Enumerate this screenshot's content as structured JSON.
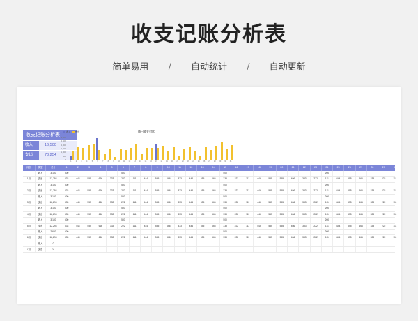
{
  "title": "收支记账分析表",
  "features": [
    "简单易用",
    "自动统计",
    "自动更新"
  ],
  "separator": "/",
  "summary": {
    "heading": "收支记账分析表",
    "income_label": "收入",
    "income_value": "16,500",
    "expense_label": "支出",
    "expense_value": "73,254"
  },
  "colors": {
    "accent": "#7b85d8",
    "income_bar": "#6b74cc",
    "expense_bar": "#f2c12e"
  },
  "chart_data": {
    "type": "bar",
    "title": "每日收支对比",
    "legend": [
      "收入",
      "支出"
    ],
    "categories": [
      "1",
      "2",
      "3",
      "4",
      "5",
      "6",
      "7",
      "8",
      "9",
      "10",
      "11",
      "12",
      "13",
      "14",
      "15",
      "16",
      "17",
      "18",
      "19",
      "20",
      "21",
      "22",
      "23",
      "24",
      "25",
      "26",
      "27",
      "28",
      "29",
      "30",
      "31"
    ],
    "y_ticks": [
      "3,000",
      "2,500",
      "2,000",
      "1,500",
      "1,000",
      "500",
      "0"
    ],
    "ylim": [
      0,
      3000
    ],
    "series": [
      {
        "name": "收入",
        "values": [
          600,
          0,
          0,
          0,
          0,
          2900,
          0,
          0,
          0,
          0,
          0,
          0,
          0,
          0,
          0,
          0,
          2200,
          0,
          0,
          0,
          0,
          0,
          0,
          0,
          0,
          0,
          0,
          0,
          0,
          0,
          0
        ]
      },
      {
        "name": "支出",
        "values": [
          1100,
          1800,
          1600,
          2000,
          2100,
          1300,
          800,
          1400,
          400,
          1500,
          1300,
          1600,
          2200,
          800,
          1600,
          1600,
          1600,
          1900,
          1100,
          1800,
          500,
          1500,
          1700,
          1200,
          600,
          1800,
          1300,
          1900,
          2300,
          1400,
          2000
        ]
      }
    ]
  },
  "table": {
    "headers": [
      "月份",
      "类型",
      "总计",
      "1",
      "2",
      "3",
      "4",
      "5",
      "6",
      "7",
      "8",
      "9",
      "10",
      "11",
      "12",
      "13",
      "14",
      "15",
      "16",
      "17",
      "18",
      "19",
      "20",
      "21",
      "22",
      "23",
      "24",
      "25",
      "26",
      "27",
      "28",
      "29",
      "30",
      "31"
    ],
    "rows": [
      {
        "month": "",
        "type": "收入",
        "total": "3,100",
        "days": [
          "600",
          "",
          "",
          "",
          "",
          "500",
          "",
          "",
          "",
          "",
          "",
          "",
          "",
          "",
          "500",
          "",
          "",
          "",
          "",
          "",
          "",
          "",
          "",
          "200",
          "",
          "",
          "",
          "",
          "",
          "",
          ""
        ]
      },
      {
        "month": "1月",
        "type": "支出",
        "total": "12,294",
        "days": [
          "333",
          "444",
          "555",
          "666",
          "333",
          "222",
          "111",
          "444",
          "555",
          "666",
          "333",
          "444",
          "555",
          "666",
          "333",
          "222",
          "111",
          "444",
          "555",
          "555",
          "666",
          "333",
          "222",
          "111",
          "444",
          "555",
          "666",
          "333",
          "222",
          "111",
          "444"
        ]
      },
      {
        "month": "",
        "type": "收入",
        "total": "3,100",
        "days": [
          "600",
          "",
          "",
          "",
          "",
          "500",
          "",
          "",
          "",
          "",
          "",
          "",
          "",
          "",
          "500",
          "",
          "",
          "",
          "",
          "",
          "",
          "",
          "",
          "200",
          "",
          "",
          "",
          "",
          "",
          "",
          ""
        ]
      },
      {
        "month": "2月",
        "type": "支出",
        "total": "12,294",
        "days": [
          "333",
          "444",
          "555",
          "666",
          "333",
          "222",
          "111",
          "444",
          "555",
          "666",
          "333",
          "444",
          "555",
          "666",
          "333",
          "222",
          "111",
          "444",
          "555",
          "555",
          "666",
          "333",
          "222",
          "111",
          "444",
          "555",
          "666",
          "333",
          "222",
          "111",
          "444"
        ]
      },
      {
        "month": "",
        "type": "收入",
        "total": "3,100",
        "days": [
          "600",
          "",
          "",
          "",
          "",
          "500",
          "",
          "",
          "",
          "",
          "",
          "",
          "",
          "",
          "500",
          "",
          "",
          "",
          "",
          "",
          "",
          "",
          "",
          "200",
          "",
          "",
          "",
          "",
          "",
          "",
          ""
        ]
      },
      {
        "month": "3月",
        "type": "支出",
        "total": "12,294",
        "days": [
          "333",
          "444",
          "555",
          "666",
          "333",
          "222",
          "111",
          "444",
          "555",
          "666",
          "333",
          "444",
          "555",
          "666",
          "333",
          "222",
          "111",
          "444",
          "555",
          "555",
          "666",
          "333",
          "222",
          "111",
          "444",
          "555",
          "666",
          "333",
          "222",
          "111",
          "444"
        ]
      },
      {
        "month": "",
        "type": "收入",
        "total": "3,100",
        "days": [
          "600",
          "",
          "",
          "",
          "",
          "500",
          "",
          "",
          "",
          "",
          "",
          "",
          "",
          "",
          "500",
          "",
          "",
          "",
          "",
          "",
          "",
          "",
          "",
          "200",
          "",
          "",
          "",
          "",
          "",
          "",
          ""
        ]
      },
      {
        "month": "4月",
        "type": "支出",
        "total": "12,294",
        "days": [
          "333",
          "444",
          "555",
          "666",
          "333",
          "222",
          "111",
          "444",
          "555",
          "666",
          "333",
          "444",
          "555",
          "666",
          "333",
          "222",
          "111",
          "444",
          "555",
          "555",
          "666",
          "333",
          "222",
          "111",
          "444",
          "555",
          "666",
          "333",
          "222",
          "111",
          "444"
        ]
      },
      {
        "month": "",
        "type": "收入",
        "total": "3,100",
        "days": [
          "600",
          "",
          "",
          "",
          "",
          "500",
          "",
          "",
          "",
          "",
          "",
          "",
          "",
          "",
          "500",
          "",
          "",
          "",
          "",
          "",
          "",
          "",
          "",
          "200",
          "",
          "",
          "",
          "",
          "",
          "",
          ""
        ]
      },
      {
        "month": "5月",
        "type": "支出",
        "total": "12,294",
        "days": [
          "333",
          "444",
          "555",
          "666",
          "333",
          "222",
          "111",
          "444",
          "555",
          "666",
          "333",
          "444",
          "555",
          "666",
          "333",
          "222",
          "111",
          "444",
          "555",
          "555",
          "666",
          "333",
          "222",
          "111",
          "444",
          "555",
          "666",
          "333",
          "222",
          "111",
          "444"
        ]
      },
      {
        "month": "",
        "type": "收入",
        "total": "2,600",
        "days": [
          "600",
          "",
          "",
          "",
          "",
          "",
          "",
          "",
          "",
          "",
          "",
          "",
          "",
          "",
          "500",
          "",
          "",
          "",
          "",
          "",
          "",
          "",
          "",
          "200",
          "",
          "",
          "",
          "",
          "",
          "",
          ""
        ]
      },
      {
        "month": "6月",
        "type": "支出",
        "total": "12,294",
        "days": [
          "333",
          "444",
          "555",
          "666",
          "333",
          "222",
          "111",
          "444",
          "555",
          "666",
          "333",
          "444",
          "555",
          "666",
          "333",
          "222",
          "111",
          "444",
          "555",
          "555",
          "666",
          "333",
          "222",
          "111",
          "444",
          "555",
          "666",
          "333",
          "222",
          "111",
          "444"
        ]
      },
      {
        "month": "",
        "type": "收入",
        "total": "0",
        "days": [
          "",
          "",
          "",
          "",
          "",
          "",
          "",
          "",
          "",
          "",
          "",
          "",
          "",
          "",
          "",
          "",
          "",
          "",
          "",
          "",
          "",
          "",
          "",
          "",
          "",
          "",
          "",
          "",
          "",
          "",
          ""
        ]
      },
      {
        "month": "7月",
        "type": "支出",
        "total": "0",
        "days": [
          "",
          "",
          "",
          "",
          "",
          "",
          "",
          "",
          "",
          "",
          "",
          "",
          "",
          "",
          "",
          "",
          "",
          "",
          "",
          "",
          "",
          "",
          "",
          "",
          "",
          "",
          "",
          "",
          "",
          "",
          ""
        ]
      }
    ]
  }
}
